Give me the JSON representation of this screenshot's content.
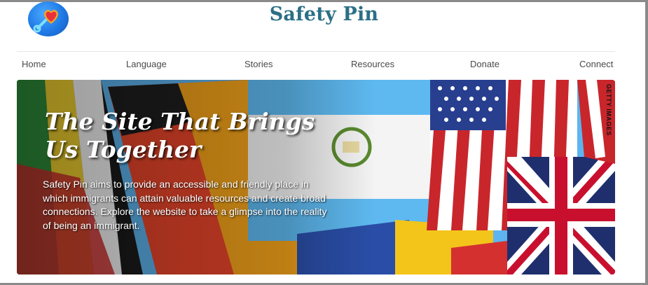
{
  "header": {
    "title": "Safety Pin",
    "logo_icon": "heart-pin-icon",
    "brand_color": "#2c6f86"
  },
  "nav": {
    "items": [
      {
        "label": "Home"
      },
      {
        "label": "Language"
      },
      {
        "label": "Stories"
      },
      {
        "label": "Resources"
      },
      {
        "label": "Donate"
      },
      {
        "label": "Connect"
      }
    ]
  },
  "hero": {
    "heading": "The Site That Brings Us Together",
    "body": "Safety Pin aims to provide an accessible and friendly place in which immigrants can attain valuable resources and create broad connections. Explore the website to take a glimpse into the reality of being an immigrant.",
    "image_credit": "GETTY IMAGES"
  }
}
